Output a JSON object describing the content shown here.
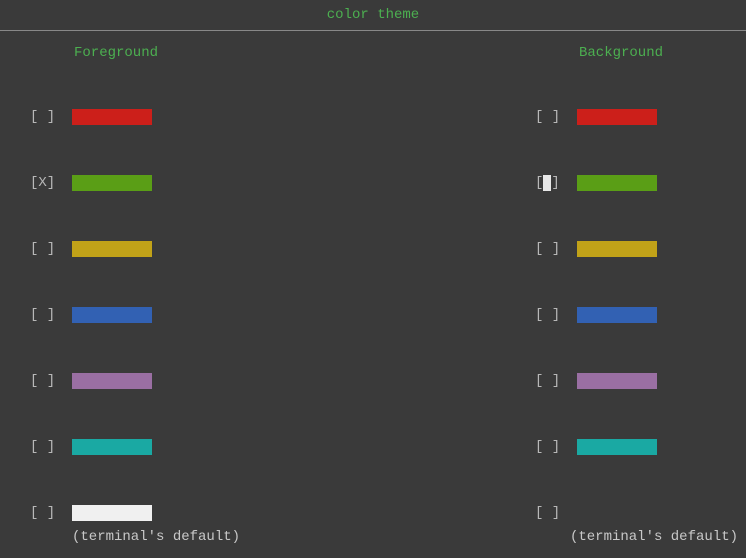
{
  "title": "color theme",
  "columns": {
    "foreground": {
      "label": "Foreground",
      "items": [
        {
          "checked": false,
          "color": "#cc1f1a",
          "label": ""
        },
        {
          "checked": true,
          "color": "#5a9e16",
          "label": ""
        },
        {
          "checked": false,
          "color": "#c1a218",
          "label": ""
        },
        {
          "checked": false,
          "color": "#3261b3",
          "label": ""
        },
        {
          "checked": false,
          "color": "#9a6fa3",
          "label": ""
        },
        {
          "checked": false,
          "color": "#1aa9a3",
          "label": ""
        },
        {
          "checked": false,
          "color": "#f0f0f0",
          "label": "(terminal's default)"
        }
      ]
    },
    "background": {
      "label": "Background",
      "items": [
        {
          "checked": false,
          "cursor": false,
          "color": "#cc1f1a",
          "label": ""
        },
        {
          "checked": false,
          "cursor": true,
          "color": "#5a9e16",
          "label": ""
        },
        {
          "checked": false,
          "cursor": false,
          "color": "#c1a218",
          "label": ""
        },
        {
          "checked": false,
          "cursor": false,
          "color": "#3261b3",
          "label": ""
        },
        {
          "checked": false,
          "cursor": false,
          "color": "#9a6fa3",
          "label": ""
        },
        {
          "checked": false,
          "cursor": false,
          "color": "#1aa9a3",
          "label": ""
        },
        {
          "checked": false,
          "cursor": false,
          "color": "",
          "label": "(terminal's default)"
        }
      ]
    }
  }
}
